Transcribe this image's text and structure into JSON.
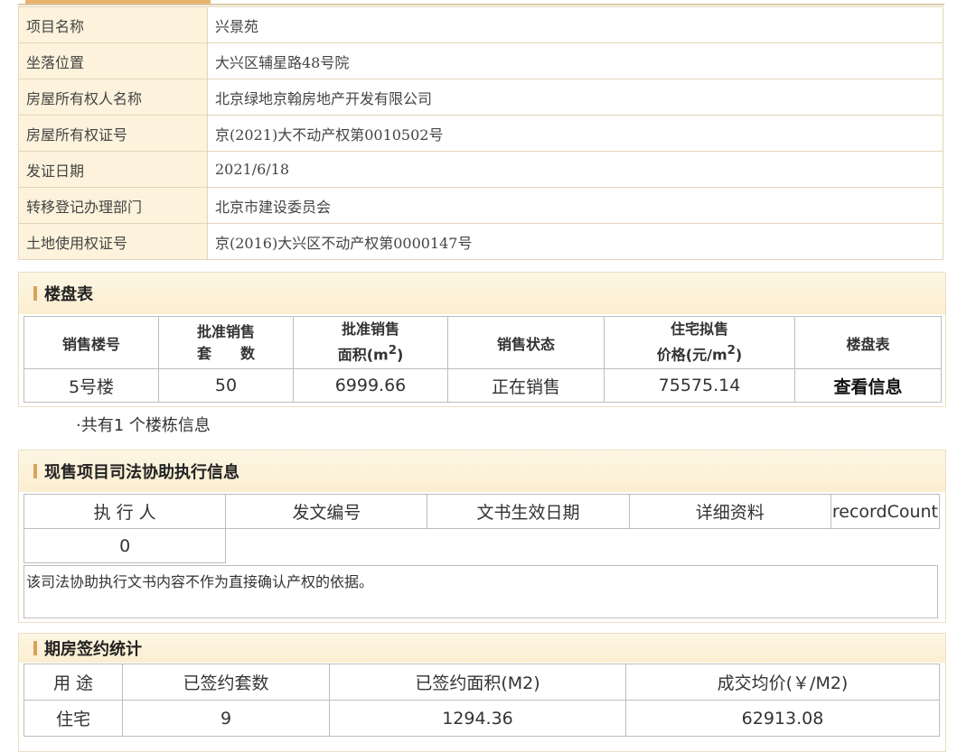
{
  "project_info": [
    {
      "label": "项目名称",
      "value": "兴景苑"
    },
    {
      "label": "坐落位置",
      "value": "大兴区辅星路48号院"
    },
    {
      "label": "房屋所有权人名称",
      "value": "北京绿地京翰房地产开发有限公司"
    },
    {
      "label": "房屋所有权证号",
      "value": "京(2021)大不动产权第0010502号"
    },
    {
      "label": "发证日期",
      "value": "2021/6/18"
    },
    {
      "label": "转移登记办理部门",
      "value": "北京市建设委员会"
    },
    {
      "label": "土地使用权证号",
      "value": "京(2016)大兴区不动产权第0000147号"
    }
  ],
  "building_table": {
    "title": "楼盘表",
    "headers": {
      "building_no": "销售楼号",
      "approved_units_line1": "批准销售",
      "approved_units_line2": "套　　数",
      "approved_area_line1": "批准销售",
      "approved_area_line2": "面积(m",
      "approved_area_sup": "2",
      "approved_area_tail": ")",
      "sale_status": "销售状态",
      "price_line1": "住宅拟售",
      "price_line2": "价格(元/m",
      "price_sup": "2",
      "price_tail": ")",
      "table_col": "楼盘表"
    },
    "row": {
      "building_no": "5号楼",
      "approved_units": "50",
      "approved_area": "6999.66",
      "sale_status": "正在销售",
      "price": "75575.14",
      "link": "查看信息"
    },
    "count_note": "·共有1 个楼栋信息"
  },
  "judicial": {
    "title": "现售项目司法协助执行信息",
    "headers": [
      "执 行 人",
      "发文编号",
      "文书生效日期",
      "详细资料",
      "recordCount"
    ],
    "value": "0",
    "note": "该司法协助执行文书内容不作为直接确认产权的依据。"
  },
  "contracts": {
    "title": "期房签约统计",
    "headers": [
      "用 途",
      "已签约套数",
      "已签约面积(M2)",
      "成交均价(￥/M2)"
    ],
    "row": [
      "住宅",
      "9",
      "1294.36",
      "62913.08"
    ]
  },
  "colors": {
    "accent": "#d7a458",
    "label_bg": "#fdf3dc"
  }
}
